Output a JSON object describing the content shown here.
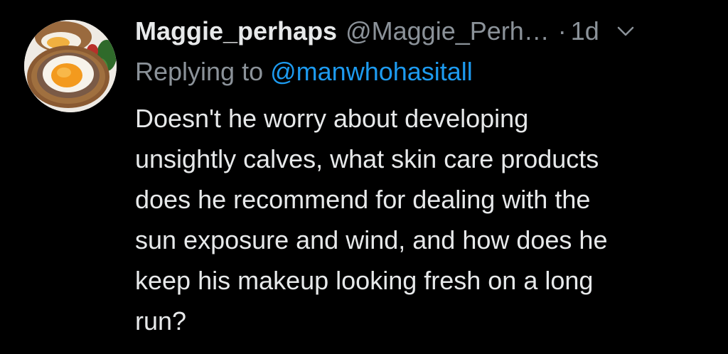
{
  "tweet": {
    "display_name": "Maggie_perhaps",
    "handle": "@Maggie_Perh…",
    "separator": "·",
    "time": "1d",
    "reply_prefix": "Replying to",
    "reply_to": "@manwhohasitall",
    "body_lines": [
      "Doesn't he worry about developing",
      "unsightly calves, what skin care products",
      "does he recommend for dealing with the",
      "sun exposure and wind, and how does he",
      "keep his makeup looking fresh on a long",
      "run?"
    ],
    "avatar_icon": "scotch-egg-photo",
    "menu_icon": "chevron-down-icon"
  },
  "colors": {
    "background": "#000000",
    "text": "#e7e9ea",
    "secondary": "#8b9299",
    "link": "#1d9bf0"
  }
}
